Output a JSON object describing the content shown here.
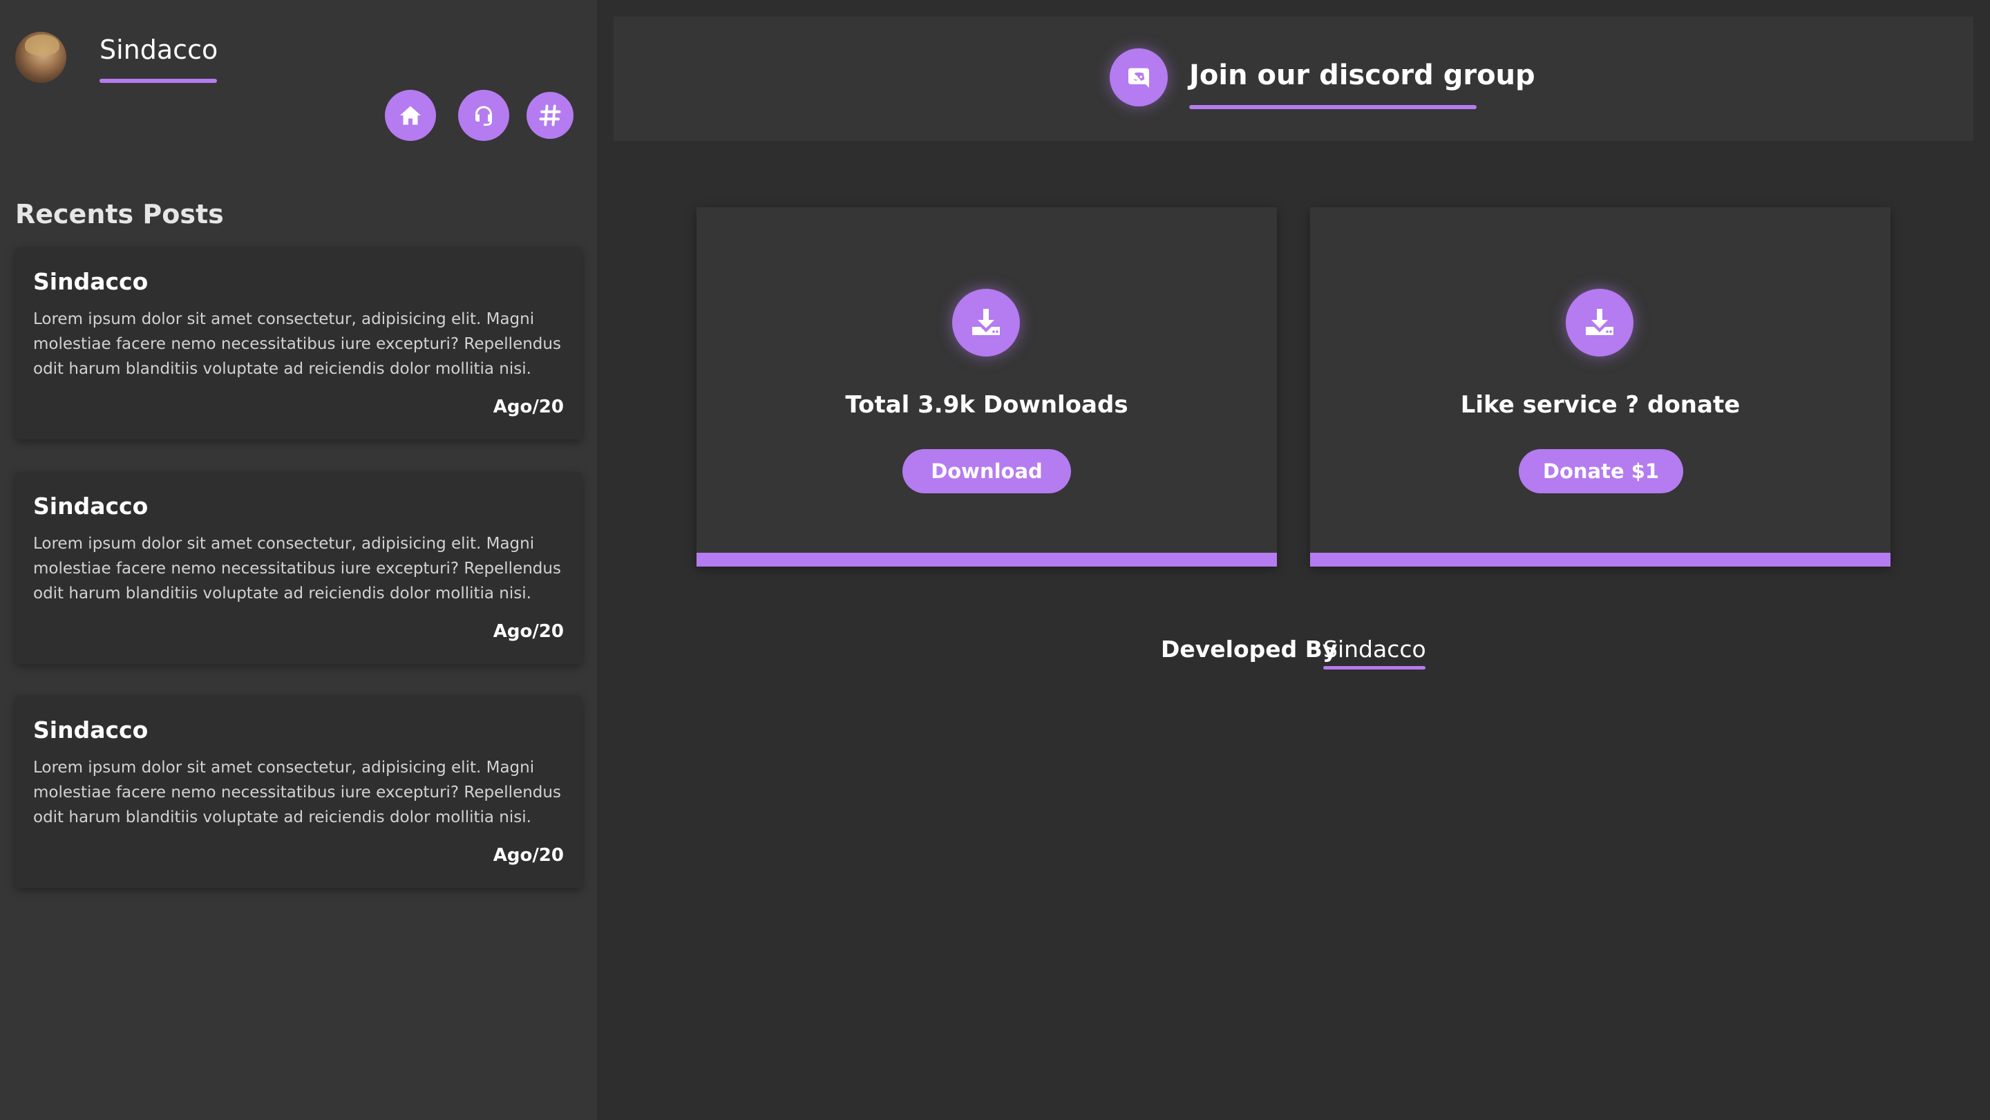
{
  "profile": {
    "name": "Sindacco",
    "avatar_icon": "user-avatar"
  },
  "nav": {
    "icons": [
      "home-icon",
      "headset-icon",
      "hashtag-icon"
    ]
  },
  "recents": {
    "title": "Recents Posts",
    "posts": [
      {
        "author": "Sindacco",
        "body": "Lorem ipsum dolor sit amet consectetur, adipisicing elit. Magni molestiae facere nemo necessitatibus iure excepturi? Repellendus odit harum blanditiis voluptate ad reiciendis dolor mollitia nisi.",
        "date": "Ago/20"
      },
      {
        "author": "Sindacco",
        "body": "Lorem ipsum dolor sit amet consectetur, adipisicing elit. Magni molestiae facere nemo necessitatibus iure excepturi? Repellendus odit harum blanditiis voluptate ad reiciendis dolor mollitia nisi.",
        "date": "Ago/20"
      },
      {
        "author": "Sindacco",
        "body": "Lorem ipsum dolor sit amet consectetur, adipisicing elit. Magni molestiae facere nemo necessitatibus iure excepturi? Repellendus odit harum blanditiis voluptate ad reiciendis dolor mollitia nisi.",
        "date": "Ago/20"
      }
    ]
  },
  "header": {
    "title": "Join our discord group",
    "icon": "discord-icon"
  },
  "cards": [
    {
      "text": "Total 3.9k Downloads",
      "button": "Download",
      "icon": "download-icon"
    },
    {
      "text": "Like service ? donate",
      "button": "Donate $1",
      "icon": "download-icon"
    }
  ],
  "footer": {
    "label": "Developed By",
    "name": "Sindacco"
  },
  "colors": {
    "accent": "#b57bf0",
    "background": "#2e2e2e",
    "panel": "#363636"
  }
}
